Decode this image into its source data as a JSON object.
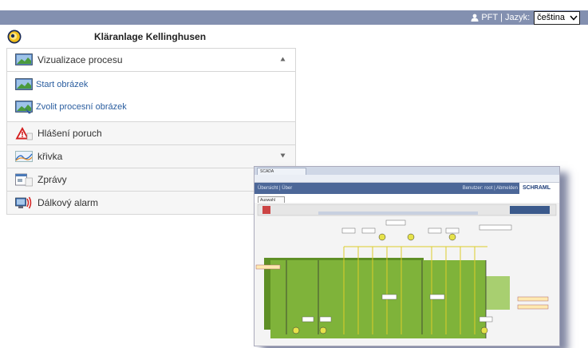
{
  "header": {
    "user_label": "PFT",
    "separator": "|",
    "language_label": "Jazyk:",
    "language_value": "čeština"
  },
  "title": "Kläranlage Kellinghusen",
  "menu": {
    "items": [
      {
        "label": "Vizualizace procesu",
        "icon": "process-visualization-icon",
        "expanded": true,
        "children": [
          {
            "label": "Start obrázek",
            "icon": "start-image-icon"
          },
          {
            "label": "Zvolit procesní obrázek",
            "icon": "select-process-image-icon"
          }
        ]
      },
      {
        "label": "Hlášení poruch",
        "icon": "fault-warning-icon"
      },
      {
        "label": "křivka",
        "icon": "curve-chart-icon",
        "expanded": false
      },
      {
        "label": "Zprávy",
        "icon": "reports-icon"
      },
      {
        "label": "Dálkový alarm",
        "icon": "remote-alarm-icon"
      }
    ]
  },
  "preview": {
    "browser_tab": "SCADA",
    "nav_left": "Übersicht | Über",
    "nav_right": "Benutzer: root | Abmelden",
    "brand": "SCHRAML",
    "select_value": "Auswahl",
    "colors": {
      "basin": "#7fb33a",
      "basin_dark": "#5e8f25",
      "nav": "#4c6798"
    }
  }
}
